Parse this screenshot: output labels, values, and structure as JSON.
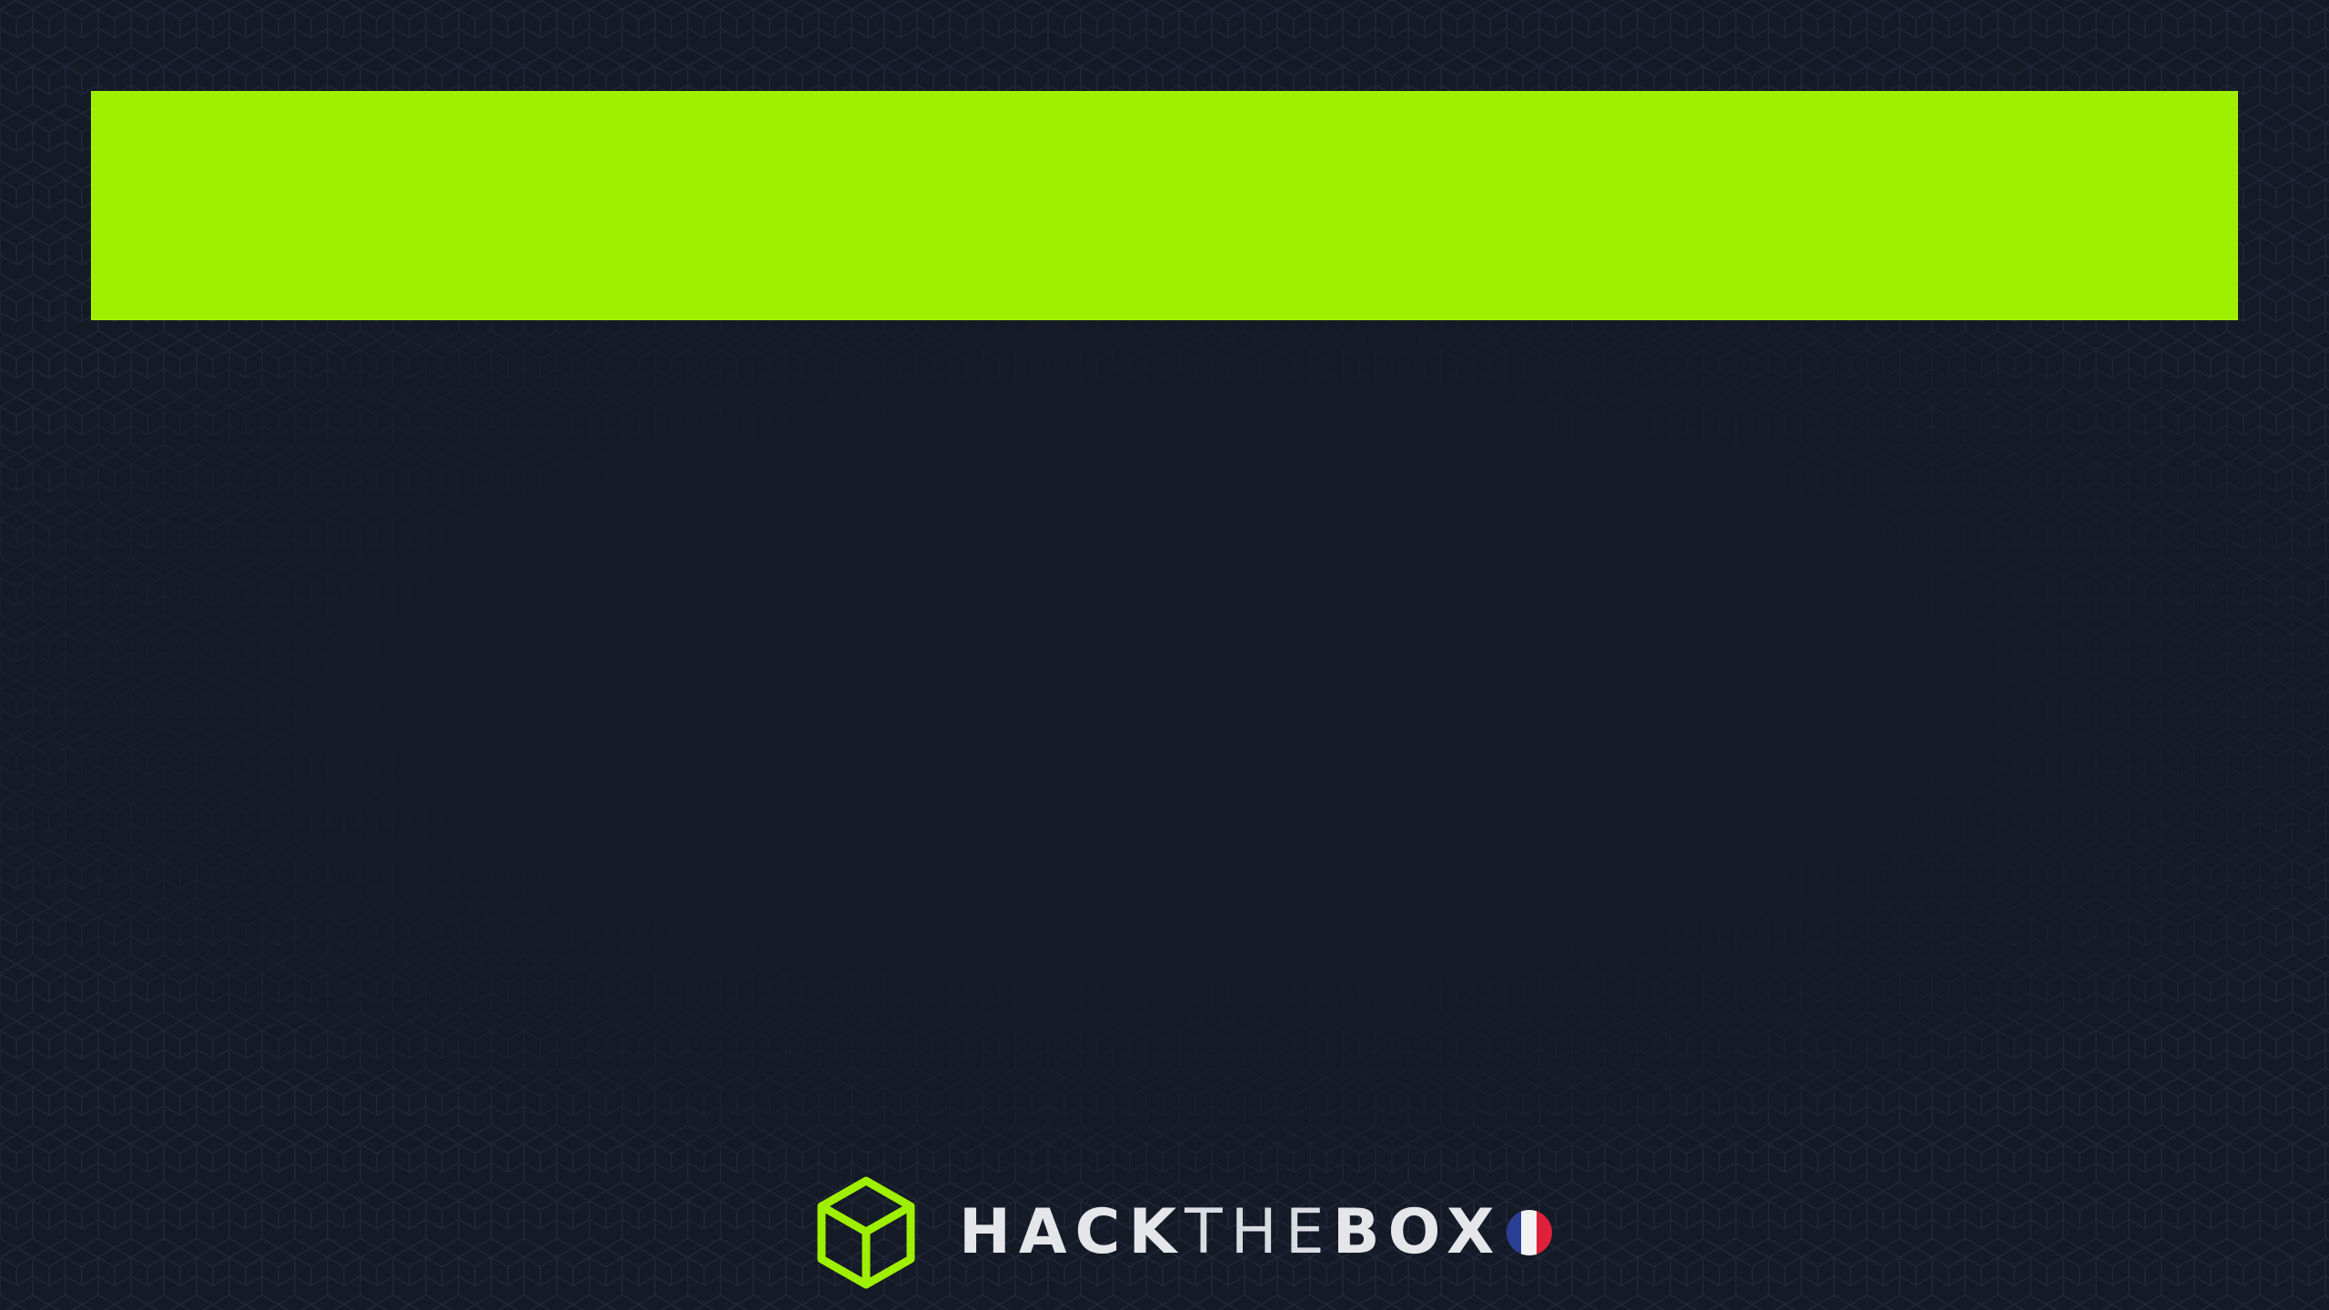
{
  "banner": {
    "color": "#9ff000"
  },
  "logo": {
    "icon": "cube-logo-icon",
    "icon_color": "#9fef00",
    "wordmark_bold_1": "HACK",
    "wordmark_light": "THE",
    "wordmark_bold_2": "BOX",
    "flag_icon": "france-flag-icon",
    "flag_colors": [
      "#2a3e95",
      "#f2f2f2",
      "#e0203a"
    ]
  },
  "colors": {
    "background": "#141a26",
    "pattern": "#1f2738",
    "text": "#e4e6ea"
  }
}
